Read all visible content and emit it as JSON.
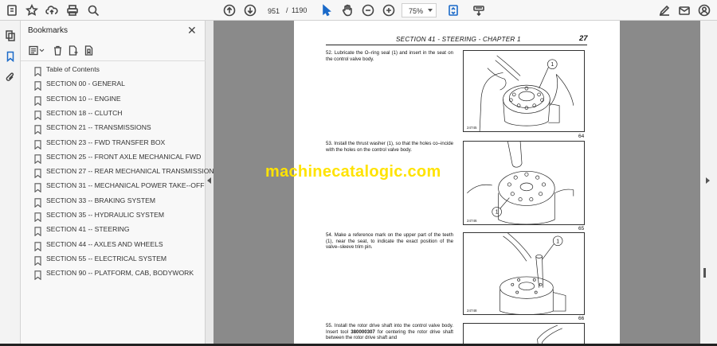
{
  "toolbar": {
    "current_page": "951",
    "page_separator": "/",
    "total_pages": "1190",
    "zoom": "75%"
  },
  "bookmarks": {
    "title": "Bookmarks",
    "items": [
      {
        "label": "Table of Contents"
      },
      {
        "label": "SECTION 00 - GENERAL"
      },
      {
        "label": "SECTION 10 -- ENGINE"
      },
      {
        "label": "SECTION 18 -- CLUTCH"
      },
      {
        "label": "SECTION 21 -- TRANSMISSIONS"
      },
      {
        "label": "SECTION 23 -- FWD TRANSFER BOX"
      },
      {
        "label": "SECTION 25 -- FRONT AXLE MECHANICAL FWD"
      },
      {
        "label": "SECTION 27 -- REAR MECHANICAL TRANSMISSION"
      },
      {
        "label": "SECTION 31 -- MECHANICAL POWER TAKE--OFF"
      },
      {
        "label": "SECTION 33 -- BRAKING SYSTEM"
      },
      {
        "label": "SECTION 35 -- HYDRAULIC SYSTEM"
      },
      {
        "label": "SECTION 41 -- STEERING"
      },
      {
        "label": "SECTION 44 -- AXLES AND WHEELS"
      },
      {
        "label": "SECTION 55 -- ELECTRICAL SYSTEM"
      },
      {
        "label": "SECTION 90 -- PLATFORM, CAB, BODYWORK"
      }
    ]
  },
  "document": {
    "header": "SECTION 41 - STEERING - CHAPTER 1",
    "page_number": "27",
    "steps": [
      {
        "text": "52.  Lubricate the O–ring seal (1) and insert in the seat on the control valve body.",
        "fig_code": "24745",
        "fig_number": "64",
        "callout": "1"
      },
      {
        "text": "53.  Install the thrust washer (1), so that the holes co–incide with the holes on the control valve body.",
        "fig_code": "24746",
        "fig_number": "65",
        "callout": "1"
      },
      {
        "text": "54.  Make a reference mark on the upper part of the teeth (1), near the seat, to indicate the exact position of the valve–sleeve trim pin.",
        "fig_code": "24748",
        "fig_number": "66",
        "callout": "1"
      },
      {
        "text_pre": "55.  Install the rotor drive shaft into the control valve body. Insert tool ",
        "tool": "380000307",
        "text_post": " for centering the rotor drive shaft between the rotor drive shaft and"
      }
    ],
    "watermark": "machinecatalogic.com"
  }
}
